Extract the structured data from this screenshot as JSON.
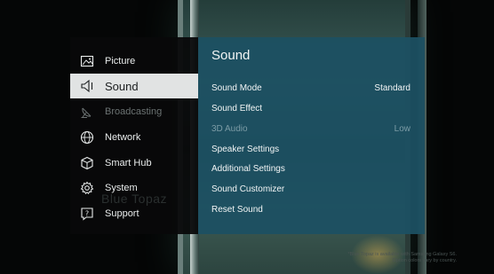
{
  "menu": {
    "items": [
      {
        "label": "Picture",
        "icon": "picture-icon",
        "state": "normal"
      },
      {
        "label": "Sound",
        "icon": "speaker-icon",
        "state": "selected"
      },
      {
        "label": "Broadcasting",
        "icon": "satellite-dish-icon",
        "state": "disabled"
      },
      {
        "label": "Network",
        "icon": "globe-icon",
        "state": "normal"
      },
      {
        "label": "Smart Hub",
        "icon": "cube-icon",
        "state": "normal"
      },
      {
        "label": "System",
        "icon": "gear-icon",
        "state": "normal"
      },
      {
        "label": "Support",
        "icon": "help-icon",
        "state": "normal"
      }
    ]
  },
  "panel": {
    "title": "Sound",
    "rows": [
      {
        "label": "Sound Mode",
        "value": "Standard",
        "state": "normal"
      },
      {
        "label": "Sound Effect",
        "value": "",
        "state": "normal"
      },
      {
        "label": "3D Audio",
        "value": "Low",
        "state": "disabled"
      },
      {
        "label": "Speaker Settings",
        "value": "",
        "state": "normal"
      },
      {
        "label": "Additional Settings",
        "value": "",
        "state": "normal"
      },
      {
        "label": "Sound Customizer",
        "value": "",
        "state": "normal"
      },
      {
        "label": "Reset Sound",
        "value": "",
        "state": "normal"
      }
    ]
  },
  "watermark": "Blue Topaz",
  "disclaimer": {
    "line1": "*Blue Topaz is available with Samsung Galaxy S6.",
    "line2": "Option colors vary by country."
  },
  "colors": {
    "panel_bg": "#1c5062",
    "selected_bg": "#e1e3e3",
    "menu_bg": "#08090a"
  }
}
